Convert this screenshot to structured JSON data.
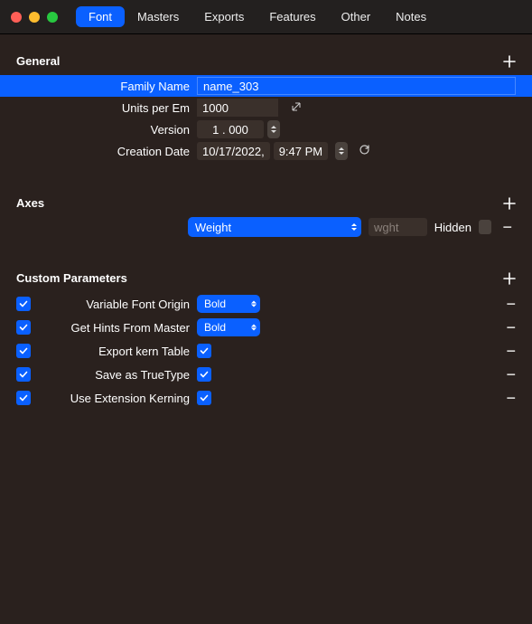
{
  "tabs": [
    "Font",
    "Masters",
    "Exports",
    "Features",
    "Other",
    "Notes"
  ],
  "activeTab": "Font",
  "sections": {
    "general": {
      "title": "General",
      "rows": {
        "familyName": {
          "label": "Family Name",
          "value": "name_303"
        },
        "unitsPerEm": {
          "label": "Units per Em",
          "value": "1000"
        },
        "version": {
          "label": "Version",
          "major": "1",
          "minor": "000"
        },
        "creationDate": {
          "label": "Creation Date",
          "date": "10/17/2022,",
          "time": "9:47 PM"
        }
      }
    },
    "axes": {
      "title": "Axes",
      "items": [
        {
          "name": "Weight",
          "tag": "wght",
          "hiddenLabel": "Hidden",
          "hidden": false
        }
      ]
    },
    "customParameters": {
      "title": "Custom Parameters",
      "items": [
        {
          "enabled": true,
          "name": "Variable Font Origin",
          "type": "select",
          "value": "Bold"
        },
        {
          "enabled": true,
          "name": "Get Hints From Master",
          "type": "select",
          "value": "Bold"
        },
        {
          "enabled": true,
          "name": "Export kern Table",
          "type": "check",
          "value": true
        },
        {
          "enabled": true,
          "name": "Save as TrueType",
          "type": "check",
          "value": true
        },
        {
          "enabled": true,
          "name": "Use Extension Kerning",
          "type": "check",
          "value": true
        }
      ]
    }
  }
}
